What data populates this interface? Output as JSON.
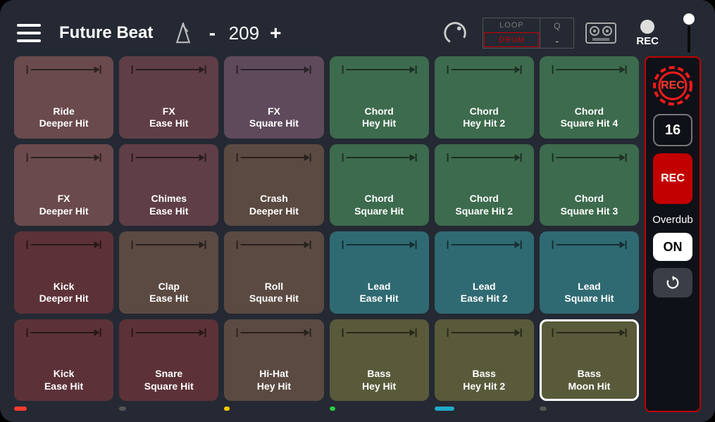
{
  "title": "Future Beat",
  "tempo": 209,
  "loop": {
    "top": "LOOP",
    "bottom": "DRUM",
    "q": "Q",
    "dash": "-"
  },
  "rec_top_label": "REC",
  "side": {
    "ring_label": "REC",
    "count": "16",
    "rec_label": "REC",
    "overdub_label": "Overdub",
    "on_label": "ON"
  },
  "pads": [
    {
      "line1": "Ride",
      "line2": "Deeper Hit",
      "color": "#6a4a4d"
    },
    {
      "line1": "FX",
      "line2": "Ease Hit",
      "color": "#5f3e47"
    },
    {
      "line1": "FX",
      "line2": "Square Hit",
      "color": "#5f4a5c"
    },
    {
      "line1": "Chord",
      "line2": "Hey Hit",
      "color": "#3d6b4d"
    },
    {
      "line1": "Chord",
      "line2": "Hey Hit 2",
      "color": "#3d6b4d"
    },
    {
      "line1": "Chord",
      "line2": "Square Hit 4",
      "color": "#3d6b4d"
    },
    {
      "line1": "FX",
      "line2": "Deeper Hit",
      "color": "#6a4a4d"
    },
    {
      "line1": "Chimes",
      "line2": "Ease Hit",
      "color": "#5f3e47"
    },
    {
      "line1": "Crash",
      "line2": "Deeper Hit",
      "color": "#5b4a42"
    },
    {
      "line1": "Chord",
      "line2": "Square Hit",
      "color": "#3d6b4d"
    },
    {
      "line1": "Chord",
      "line2": "Square Hit 2",
      "color": "#3d6b4d"
    },
    {
      "line1": "Chord",
      "line2": "Square Hit 3",
      "color": "#3d6b4d"
    },
    {
      "line1": "Kick",
      "line2": "Deeper Hit",
      "color": "#5c3238"
    },
    {
      "line1": "Clap",
      "line2": "Ease Hit",
      "color": "#5b4a42"
    },
    {
      "line1": "Roll",
      "line2": "Square Hit",
      "color": "#5b4a42"
    },
    {
      "line1": "Lead",
      "line2": "Ease Hit",
      "color": "#2f6a72"
    },
    {
      "line1": "Lead",
      "line2": "Ease Hit 2",
      "color": "#2f6a72"
    },
    {
      "line1": "Lead",
      "line2": "Square Hit",
      "color": "#2f6a72"
    },
    {
      "line1": "Kick",
      "line2": "Ease Hit",
      "color": "#5c3238"
    },
    {
      "line1": "Snare",
      "line2": "Square Hit",
      "color": "#5c3238"
    },
    {
      "line1": "Hi-Hat",
      "line2": "Hey Hit",
      "color": "#5b4a42"
    },
    {
      "line1": "Bass",
      "line2": "Hey Hit",
      "color": "#595a3a"
    },
    {
      "line1": "Bass",
      "line2": "Hey Hit 2",
      "color": "#595a3a"
    },
    {
      "line1": "Bass",
      "line2": "Moon Hit",
      "color": "#595a3a",
      "selected": true
    }
  ],
  "indicators": [
    {
      "color": "#ff3b30",
      "width": 18
    },
    {
      "color": "#555555",
      "width": 10
    },
    {
      "color": "#ffcc00",
      "width": 8
    },
    {
      "color": "#2ecc40",
      "width": 8
    },
    {
      "color": "#1fa9c9",
      "width": 28
    },
    {
      "color": "#555555",
      "width": 10
    }
  ]
}
